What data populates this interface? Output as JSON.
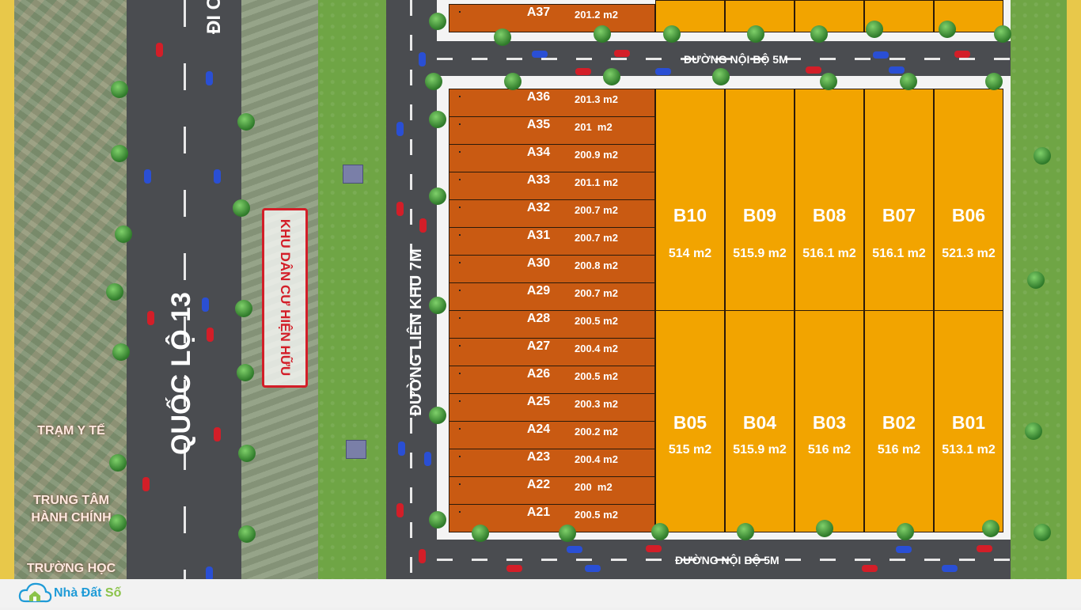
{
  "map": {
    "highway_label": "QUỐC LỘ 13",
    "top_cut_label": "ĐI C",
    "residential_label": "KHU DÂN CƯ HIỆN HỮU",
    "road_7m_label": "ĐƯỜNG LIÊN KHU 7M",
    "road_5m_top_label": "ĐƯỜNG NỘI BỘ 5M",
    "road_5m_bottom_label": "ĐƯỜNG NỘI BỘ 5M",
    "city_labels": [
      "TRẠM Y TẾ",
      "TRUNG TÂM HÀNH CHÍNH",
      "TRƯỜNG HỌC"
    ]
  },
  "lots_a": [
    {
      "code": "A37",
      "area": "201.2 m2"
    },
    {
      "code": "A36",
      "area": "201.3 m2"
    },
    {
      "code": "A35",
      "area": "201  m2"
    },
    {
      "code": "A34",
      "area": "200.9 m2"
    },
    {
      "code": "A33",
      "area": "201.1 m2"
    },
    {
      "code": "A32",
      "area": "200.7 m2"
    },
    {
      "code": "A31",
      "area": "200.7 m2"
    },
    {
      "code": "A30",
      "area": "200.8 m2"
    },
    {
      "code": "A29",
      "area": "200.7 m2"
    },
    {
      "code": "A28",
      "area": "200.5 m2"
    },
    {
      "code": "A27",
      "area": "200.4 m2"
    },
    {
      "code": "A26",
      "area": "200.5 m2"
    },
    {
      "code": "A25",
      "area": "200.3 m2"
    },
    {
      "code": "A24",
      "area": "200.2 m2"
    },
    {
      "code": "A23",
      "area": "200.4 m2"
    },
    {
      "code": "A22",
      "area": "200  m2"
    },
    {
      "code": "A21",
      "area": "200.5 m2"
    }
  ],
  "lots_b_top": [
    {
      "code": "B10",
      "area": "514 m2"
    },
    {
      "code": "B09",
      "area": "515.9 m2"
    },
    {
      "code": "B08",
      "area": "516.1 m2"
    },
    {
      "code": "B07",
      "area": "516.1 m2"
    },
    {
      "code": "B06",
      "area": "521.3 m2"
    }
  ],
  "lots_b_bottom": [
    {
      "code": "B05",
      "area": "515 m2"
    },
    {
      "code": "B04",
      "area": "515.9 m2"
    },
    {
      "code": "B03",
      "area": "516 m2"
    },
    {
      "code": "B02",
      "area": "516 m2"
    },
    {
      "code": "B01",
      "area": "513.1 m2"
    }
  ],
  "footer": {
    "logo_text_main": "Nhà Đất ",
    "logo_text_accent": "Số",
    "logo_icon": "cloud-house-icon",
    "accent_color": "#8bc34a",
    "brand_color": "#1f9bd7"
  },
  "colors": {
    "lot_a": "#c95a12",
    "lot_b": "#f2a400",
    "grass": "#6fa545",
    "road": "#4a4c50"
  }
}
